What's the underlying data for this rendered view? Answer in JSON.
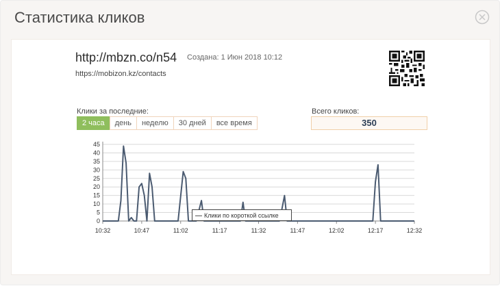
{
  "modal": {
    "title": "Статистика кликов"
  },
  "link": {
    "short_url": "http://mbzn.co/n54",
    "created": "Создана: 1 Июн 2018 10:12",
    "long_url": "https://mobizon.kz/contacts"
  },
  "period": {
    "label": "Клики за последние:",
    "tabs": [
      {
        "label": "2 часа",
        "active": true
      },
      {
        "label": "день",
        "active": false
      },
      {
        "label": "неделю",
        "active": false
      },
      {
        "label": "30 дней",
        "active": false
      },
      {
        "label": "все время",
        "active": false
      }
    ]
  },
  "total": {
    "label": "Всего кликов:",
    "value": "350"
  },
  "legend": {
    "label": "Клики по короткой ссылке"
  },
  "colors": {
    "active_tab": "#8fbe5d",
    "line": "#4a5a70",
    "grid": "#d9d9d9"
  },
  "chart_data": {
    "type": "line",
    "xlabel": "",
    "ylabel": "",
    "xlim": [
      "10:32",
      "12:32"
    ],
    "ylim": [
      0,
      45
    ],
    "grid": "horizontal",
    "legend_position": "bottom-center",
    "x_ticks": [
      "10:32",
      "10:47",
      "11:02",
      "11:17",
      "11:32",
      "11:47",
      "12:02",
      "12:17",
      "12:32"
    ],
    "y_ticks": [
      0,
      5,
      10,
      15,
      20,
      25,
      30,
      35,
      40,
      45
    ],
    "series": [
      {
        "name": "Клики по короткой ссылке",
        "points": [
          [
            "10:32",
            0
          ],
          [
            "10:38",
            0
          ],
          [
            "10:39",
            12
          ],
          [
            "10:40",
            44
          ],
          [
            "10:41",
            34
          ],
          [
            "10:42",
            0
          ],
          [
            "10:43",
            2
          ],
          [
            "10:44",
            0
          ],
          [
            "10:45",
            0
          ],
          [
            "10:46",
            20
          ],
          [
            "10:47",
            22
          ],
          [
            "10:48",
            15
          ],
          [
            "10:49",
            0
          ],
          [
            "10:50",
            28
          ],
          [
            "10:51",
            20
          ],
          [
            "10:52",
            0
          ],
          [
            "11:01",
            0
          ],
          [
            "11:03",
            29
          ],
          [
            "11:04",
            25
          ],
          [
            "11:05",
            0
          ],
          [
            "11:08",
            0
          ],
          [
            "11:09",
            6
          ],
          [
            "11:10",
            12
          ],
          [
            "11:11",
            0
          ],
          [
            "11:25",
            0
          ],
          [
            "11:26",
            11
          ],
          [
            "11:27",
            0
          ],
          [
            "11:40",
            0
          ],
          [
            "11:41",
            7
          ],
          [
            "11:42",
            15
          ],
          [
            "11:43",
            0
          ],
          [
            "12:16",
            0
          ],
          [
            "12:17",
            23
          ],
          [
            "12:18",
            33
          ],
          [
            "12:19",
            0
          ],
          [
            "12:32",
            0
          ]
        ]
      }
    ]
  }
}
